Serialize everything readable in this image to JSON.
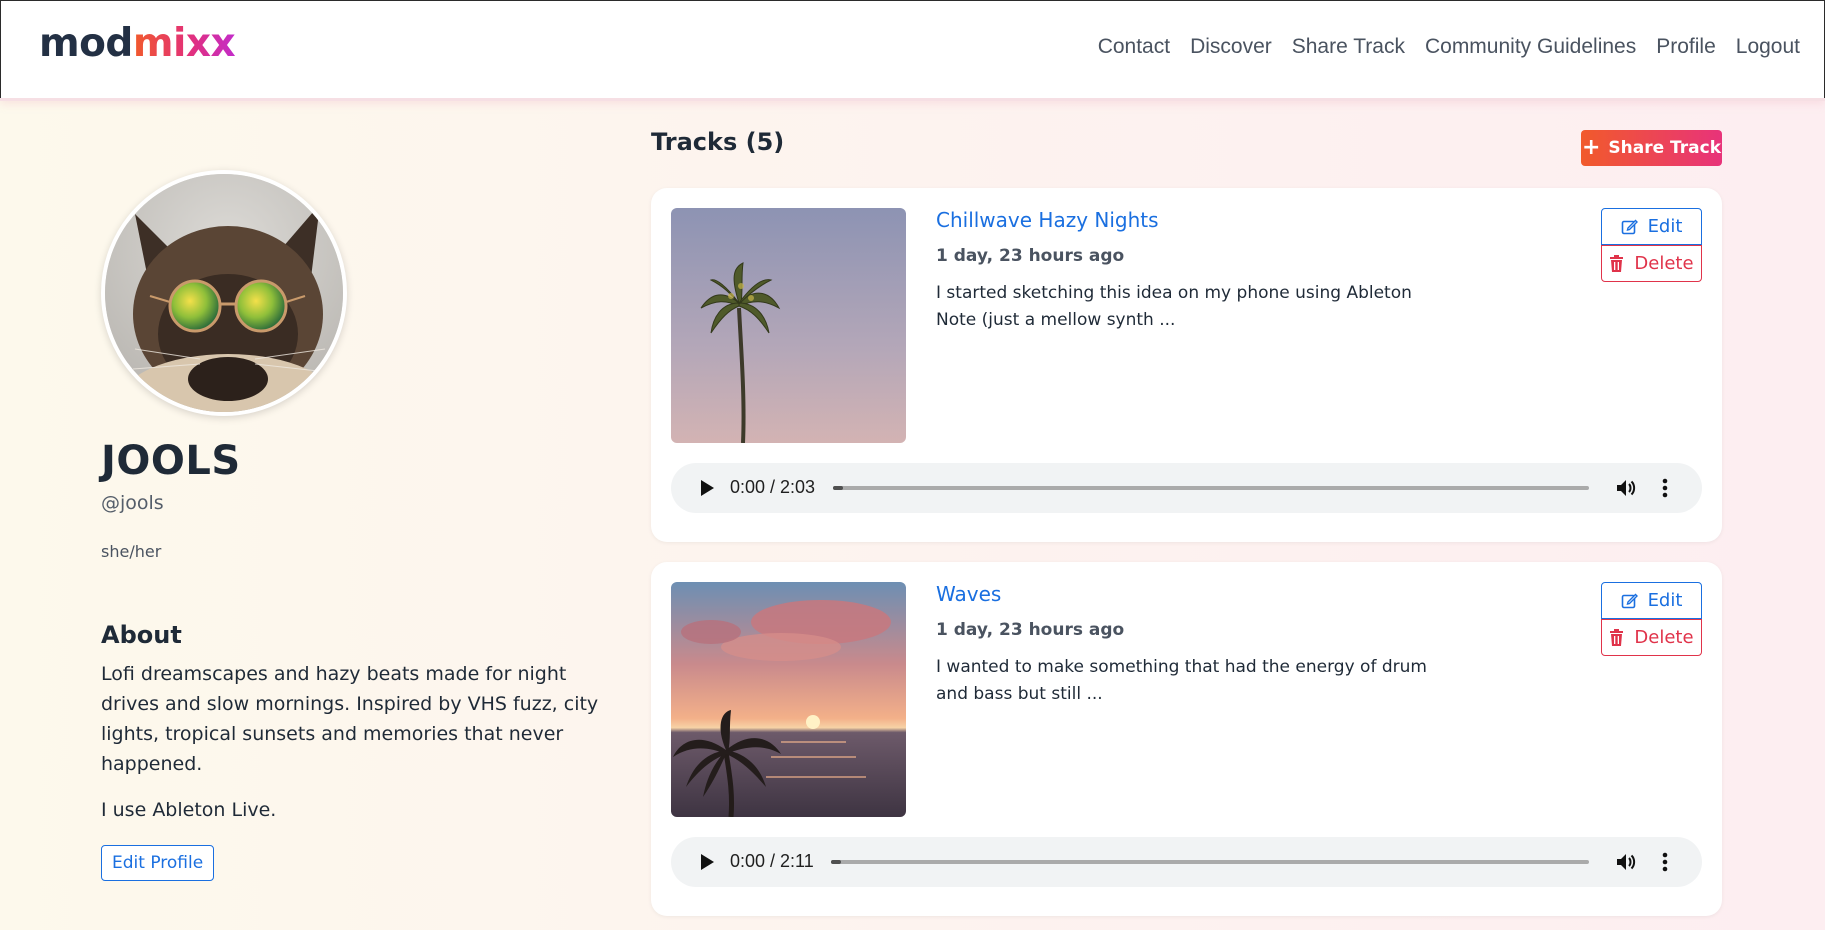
{
  "brand": {
    "part1": "mod",
    "part2": "mixx"
  },
  "nav": {
    "links": [
      "Contact",
      "Discover",
      "Share Track",
      "Community Guidelines",
      "Profile",
      "Logout"
    ]
  },
  "profile": {
    "display_name": "JOOLS",
    "handle": "@jools",
    "pronouns": "she/her",
    "about_heading": "About",
    "about_text": "Lofi dreamscapes and hazy beats made for night drives and slow mornings. Inspired by VHS fuzz, city lights, tropical sunsets and memories that never happened.",
    "about_text2": "I use Ableton Live.",
    "edit_profile_label": "Edit Profile"
  },
  "tracks": {
    "heading": "Tracks (5)",
    "share_label": "Share Track",
    "items": [
      {
        "title": "Chillwave Hazy Nights",
        "time_ago": "1 day, 23 hours ago",
        "description": "I started sketching this idea on my phone using Ableton Note (just a mellow synth ...",
        "edit_label": "Edit",
        "delete_label": "Delete",
        "player_time": "0:00 / 2:03",
        "progress": 0
      },
      {
        "title": "Waves",
        "time_ago": "1 day, 23 hours ago",
        "description": "I wanted to make something that had the energy of drum and bass but still ...",
        "edit_label": "Edit",
        "delete_label": "Delete",
        "player_time": "0:00 / 2:11",
        "progress": 0
      }
    ]
  },
  "colors": {
    "accent_blue": "#1a6fe0",
    "danger_red": "#e0334a",
    "brand_orange": "#f15a2b",
    "brand_pink": "#e3307a"
  }
}
